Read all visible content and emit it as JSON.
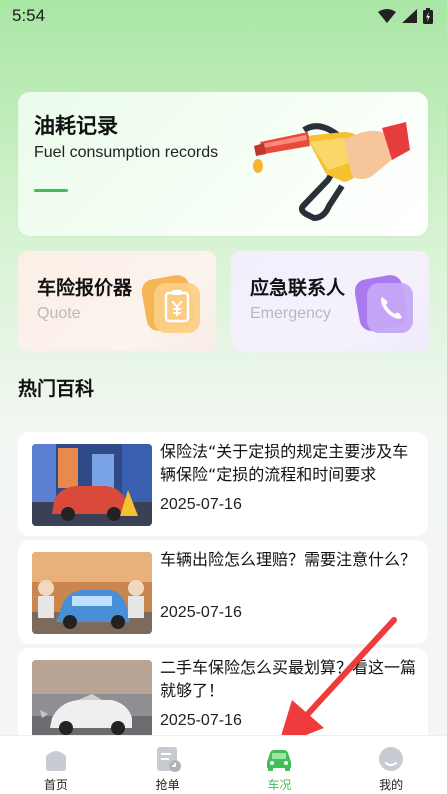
{
  "status_bar": {
    "time": "5:54"
  },
  "fuel_card": {
    "title": "油耗记录",
    "subtitle": "Fuel consumption records"
  },
  "quick_cards": [
    {
      "title": "车险报价器",
      "subtitle": "Quote",
      "icon": "clipboard-yen-icon"
    },
    {
      "title": "应急联系人",
      "subtitle": "Emergency",
      "icon": "phone-icon"
    }
  ],
  "section": {
    "title": "热门百科"
  },
  "articles": [
    {
      "title": "保险法“关于定损的规定主要涉及车辆保险“定损的流程和时间要求",
      "date": "2025-07-16"
    },
    {
      "title": "车辆出险怎么理赔？需要注意什么？",
      "date": "2025-07-16"
    },
    {
      "title": "二手车保险怎么买最划算？看这一篇就够了！",
      "date": "2025-07-16"
    }
  ],
  "tabbar": {
    "active_color": "#3fbf55",
    "items": [
      {
        "label": "首页",
        "icon": "home-icon"
      },
      {
        "label": "抢单",
        "icon": "order-icon"
      },
      {
        "label": "车况",
        "icon": "car-icon"
      },
      {
        "label": "我的",
        "icon": "profile-icon"
      }
    ]
  }
}
